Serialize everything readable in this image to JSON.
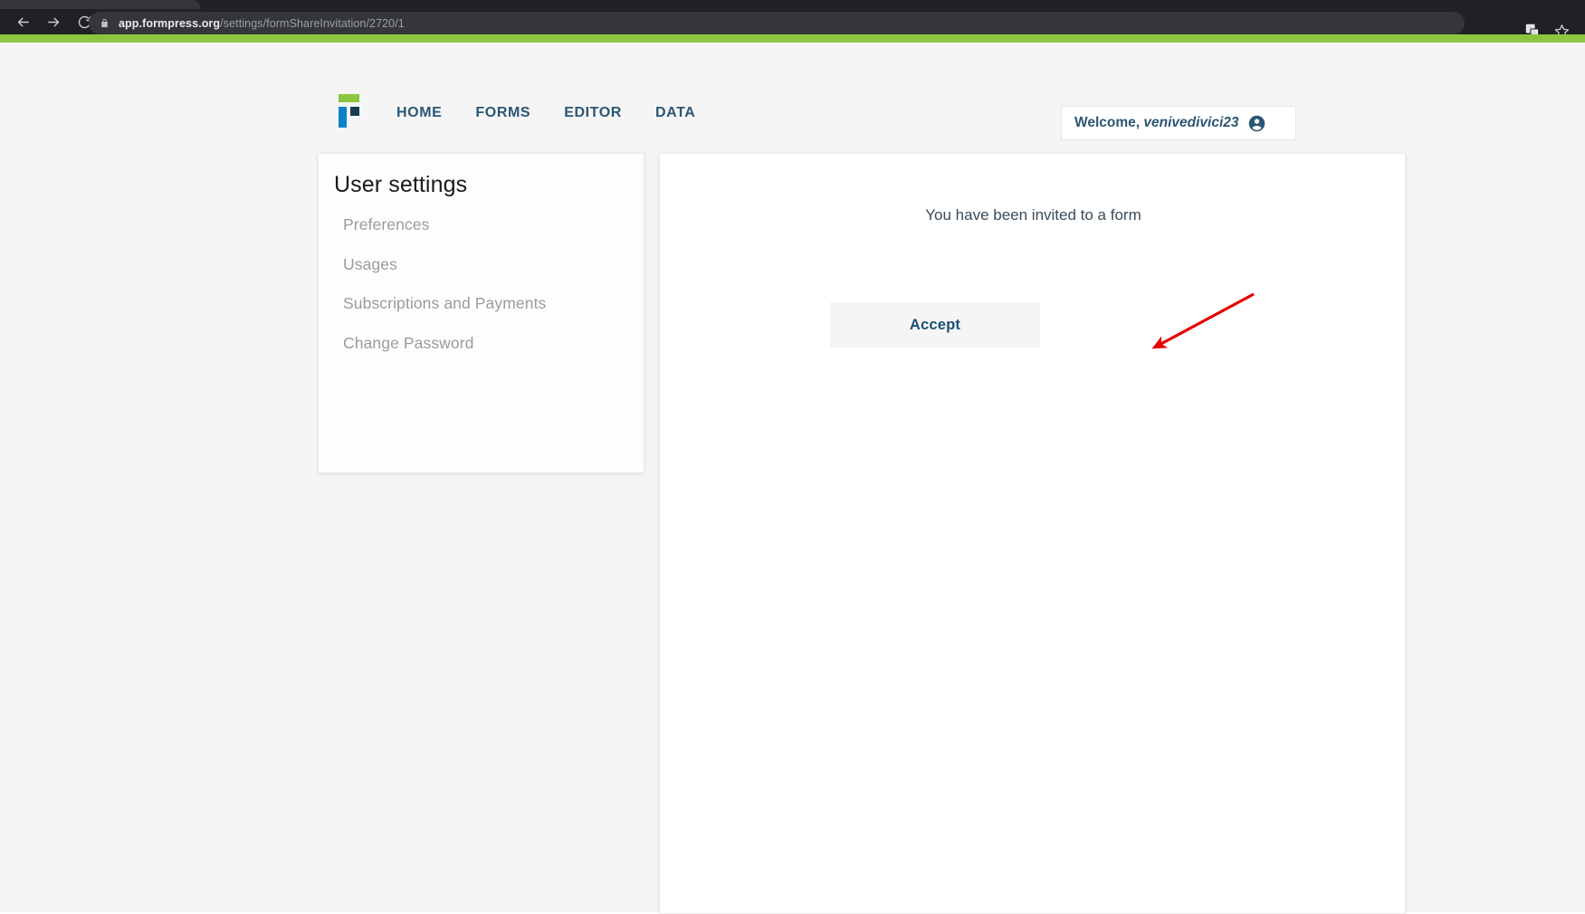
{
  "browser": {
    "back_icon": "back-arrow-icon",
    "forward_icon": "forward-arrow-icon",
    "reload_icon": "reload-icon",
    "lock_icon": "lock-icon",
    "url_host": "app.formpress.org",
    "url_path": "/settings/formShareInvitation/2720/1",
    "translate_icon": "translate-icon",
    "bookmark_icon": "star-bookmark-icon"
  },
  "app": {
    "accent_green": "#8cc63f",
    "accent_blue": "#0b82c7",
    "accent_navy": "#163c54",
    "brand_text": "#2b5674",
    "logo_name": "formpress-logo",
    "nav": [
      {
        "label": "HOME"
      },
      {
        "label": "FORMS"
      },
      {
        "label": "EDITOR"
      },
      {
        "label": "DATA"
      }
    ],
    "welcome": {
      "prefix": "Welcome,",
      "username": "venivedivici23",
      "avatar_icon": "account-circle-icon"
    }
  },
  "sidebar": {
    "title": "User settings",
    "items": [
      {
        "label": "Preferences"
      },
      {
        "label": "Usages"
      },
      {
        "label": "Subscriptions and Payments"
      },
      {
        "label": "Change Password"
      }
    ]
  },
  "main": {
    "invite_message": "You have been invited to a form",
    "accept_label": "Accept"
  },
  "annotation": {
    "arrow_color": "#e60000",
    "points_to": "accept-button"
  }
}
